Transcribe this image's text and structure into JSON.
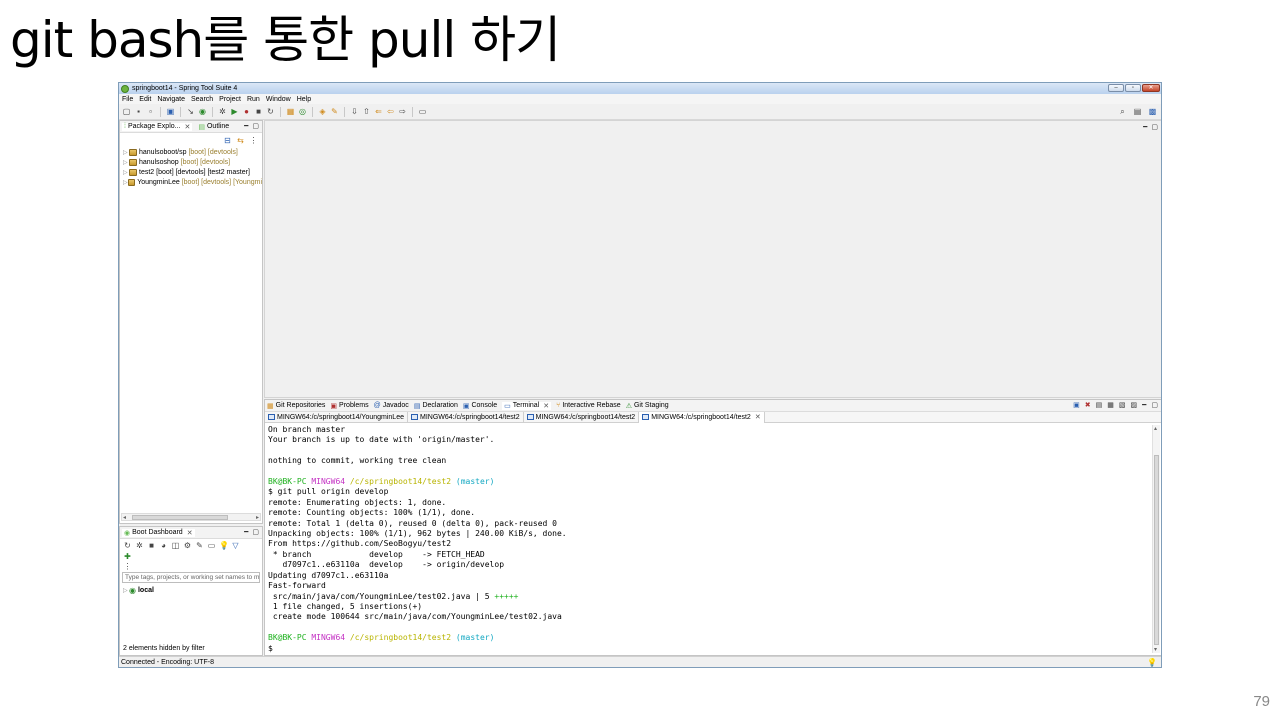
{
  "slide": {
    "title": "git bash를 통한 pull 하기",
    "page_number": "79"
  },
  "window": {
    "title": "springboot14 - Spring Tool Suite 4",
    "controls": {
      "minimize": "–",
      "maximize": "▫",
      "close": "✕"
    }
  },
  "menu": [
    "File",
    "Edit",
    "Navigate",
    "Search",
    "Project",
    "Run",
    "Window",
    "Help"
  ],
  "package_explorer": {
    "tabs": [
      "Package Explo...",
      "Outline"
    ],
    "projects": [
      {
        "name": "hanulsoboot/sp",
        "decoration": "[boot] [devtools]"
      },
      {
        "name": "hanulsoshop",
        "decoration": "[boot] [devtools]"
      },
      {
        "name": "test2 [boot] [devtools] [test2 master]",
        "decoration": ""
      },
      {
        "name": "YoungminLee",
        "decoration": "[boot] [devtools] [Youngmi"
      }
    ]
  },
  "boot_dashboard": {
    "tab": "Boot Dashboard",
    "filter_placeholder": "Type tags, projects, or working set names to m",
    "items": [
      "local"
    ],
    "footer": "2 elements hidden by filter"
  },
  "bottom_views": {
    "tabs": [
      "Git Repositories",
      "Problems",
      "Javadoc",
      "Declaration",
      "Console",
      "Terminal",
      "Interactive Rebase",
      "Git Staging"
    ],
    "active_tab": "Terminal"
  },
  "terminal_tabs": [
    "MINGW64:/c/springboot14/YoungminLee",
    "MINGW64:/c/springboot14/test2",
    "MINGW64:/c/springboot14/test2",
    "MINGW64:/c/springboot14/test2"
  ],
  "terminal": {
    "line1": "On branch master",
    "line2": "Your branch is up to date with 'origin/master'.",
    "line3": "",
    "line4": "nothing to commit, working tree clean",
    "line5": "",
    "prompt_user": "BK@BK-PC",
    "prompt_shell": "MINGW64",
    "prompt_path": "/c/springboot14/test2",
    "prompt_branch": "(master)",
    "cmd": "$ git pull origin develop",
    "out1": "remote: Enumerating objects: 1, done.",
    "out2": "remote: Counting objects: 100% (1/1), done.",
    "out3": "remote: Total 1 (delta 0), reused 0 (delta 0), pack-reused 0",
    "out4": "Unpacking objects: 100% (1/1), 962 bytes | 240.00 KiB/s, done.",
    "out5": "From https://github.com/SeoBogyu/test2",
    "out6": " * branch            develop    -> FETCH_HEAD",
    "out7": "   d7097c1..e63110a  develop    -> origin/develop",
    "out8": "Updating d7097c1..e63110a",
    "out9": "Fast-forward",
    "out10_file": " src/main/java/com/YoungminLee/test02.java | 5 ",
    "out10_plus": "+++++",
    "out11": " 1 file changed, 5 insertions(+)",
    "out12": " create mode 100644 src/main/java/com/YoungminLee/test02.java",
    "final_prompt": "$"
  },
  "status_bar": "Connected - Encoding: UTF-8"
}
